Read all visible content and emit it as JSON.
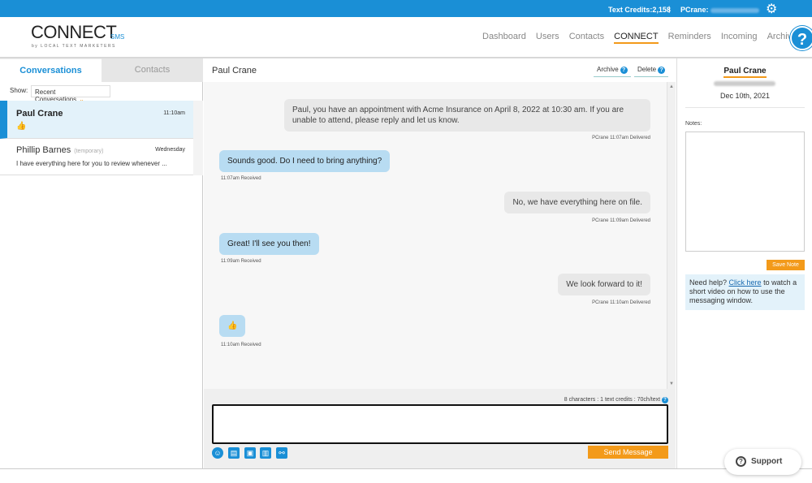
{
  "topbar": {
    "credits": "Text Credits:2,158",
    "separator": "|",
    "user_label": "PCrane:",
    "settings_icon": "gear-icon"
  },
  "logo": {
    "main": "CONNECT",
    "suffix": "SMS",
    "tagline": "by LOCAL TEXT MARKETERS"
  },
  "nav": {
    "items": [
      "Dashboard",
      "Users",
      "Contacts",
      "CONNECT",
      "Reminders",
      "Incoming",
      "Archives"
    ],
    "active": "CONNECT",
    "help_icon": "?"
  },
  "left": {
    "tabs": [
      "Conversations",
      "Contacts"
    ],
    "show_label": "Show:",
    "show_value": "Recent Conversations",
    "conversations": [
      {
        "name": "Paul Crane",
        "time": "11:10am",
        "preview": "👍",
        "temporary": ""
      },
      {
        "name": "Phillip Barnes",
        "temporary": "(temporary)",
        "time": "Wednesday",
        "preview": "I have everything here for you to review whenever ..."
      }
    ]
  },
  "middle": {
    "title": "Paul Crane",
    "archive_label": "Archive",
    "delete_label": "Delete",
    "messages": [
      {
        "dir": "out",
        "text": "Paul, you have an appointment with Acme Insurance on April 8, 2022 at 10:30 am. If you are unable to attend, please reply and let us know.",
        "meta": "PCrane  11:07am  Delivered"
      },
      {
        "dir": "in",
        "text": "Sounds good. Do I need to bring anything?",
        "meta": "11:07am  Received"
      },
      {
        "dir": "out",
        "text": "No, we have everything here on file.",
        "meta": "PCrane  11:09am  Delivered"
      },
      {
        "dir": "in",
        "text": "Great! I'll see you then!",
        "meta": "11:09am  Received"
      },
      {
        "dir": "out",
        "text": "We look forward to it!",
        "meta": "PCrane  11:10am  Delivered"
      },
      {
        "dir": "in",
        "text": "👍",
        "meta": "11:10am  Received"
      }
    ],
    "counter": "8 characters : 1 text credits : 70ch/text",
    "send_label": "Send Message"
  },
  "right": {
    "name": "Paul Crane",
    "date": "Dec 10th, 2021",
    "notes_label": "Notes:",
    "save_label": "Save Note",
    "help_prefix": "Need help? ",
    "help_link": "Click here",
    "help_suffix": " to watch a short video on how to use the messaging window."
  },
  "support": {
    "label": "Support"
  },
  "colors": {
    "brand_blue": "#1a8fd6",
    "accent_orange": "#f39a1a",
    "incoming_bubble": "#b8dcf2",
    "outgoing_bubble": "#e8e8e8"
  }
}
